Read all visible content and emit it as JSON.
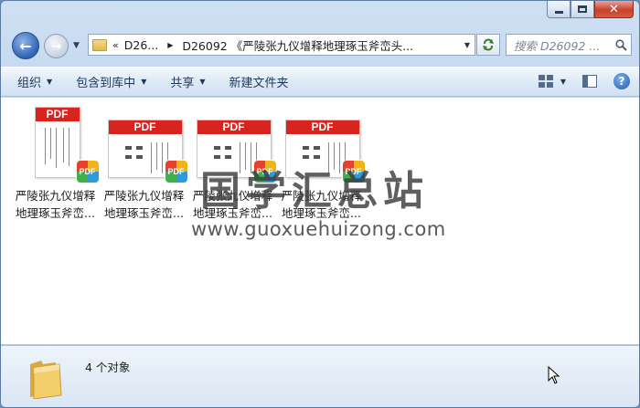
{
  "window": {
    "caption": {
      "minimize": "minimize",
      "maximize": "maximize",
      "close": "close"
    }
  },
  "nav": {
    "breadcrumb": {
      "chevrons": "«",
      "part1": "D26...",
      "part2": "D26092 《严陵张九仪增释地理琢玉斧峦头..."
    },
    "search_placeholder": "搜索 D26092 ..."
  },
  "toolbar": {
    "organize": "组织",
    "include_in_library": "包含到库中",
    "share": "共享",
    "new_folder": "新建文件夹"
  },
  "files": [
    {
      "line1": "严陵张九仪增释",
      "line2": "地理琢玉斧峦..."
    },
    {
      "line1": "严陵张九仪增释",
      "line2": "地理琢玉斧峦..."
    },
    {
      "line1": "严陵张九仪增释",
      "line2": "地理琢玉斧峦..."
    },
    {
      "line1": "严陵张九仪增释",
      "line2": "地理琢玉斧峦..."
    }
  ],
  "thumbnail_banner": "PDF",
  "thumbnail_badge": "PDF",
  "watermark": {
    "title": "国学汇总站",
    "url": "www.guoxuehuizong.com"
  },
  "status": {
    "item_count": "4 个对象"
  },
  "icons": [
    "back-arrow-icon",
    "forward-arrow-icon",
    "folder-icon",
    "refresh-icon",
    "search-icon",
    "view-options-icon",
    "preview-pane-icon",
    "help-icon",
    "pdf-icon",
    "cursor-icon"
  ],
  "colors": {
    "pdf_red": "#d8241f",
    "toolbar_text": "#1e395b",
    "accent_blue": "#2f63b6"
  }
}
